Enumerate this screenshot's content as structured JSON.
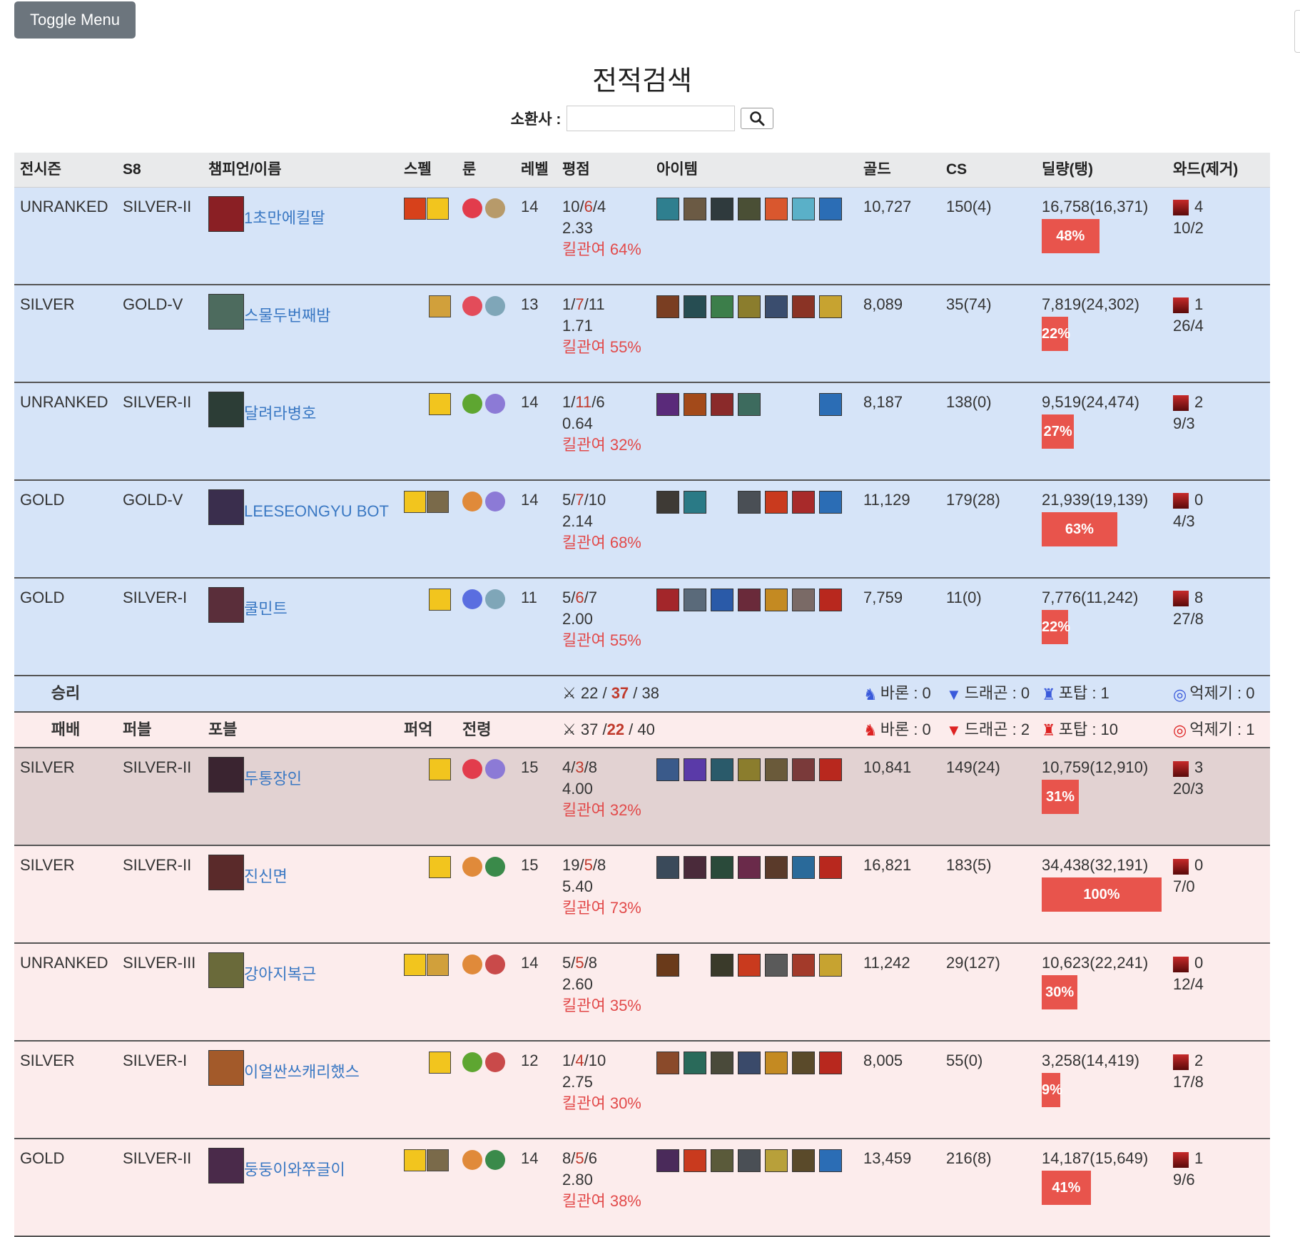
{
  "toggle_label": "Toggle Menu",
  "title": "전적검색",
  "search": {
    "label": "소환사 :",
    "value": "",
    "placeholder": ""
  },
  "columns": [
    "전시즌",
    "S8",
    "챔피언/이름",
    "스펠",
    "룬",
    "레벨",
    "평점",
    "아이템",
    "골드",
    "CS",
    "딜량(탱)",
    "와드(제거)"
  ],
  "win_team": [
    {
      "prev": "UNRANKED",
      "s8": "SILVER-II",
      "name": "1초만에킬딸",
      "portrait": "#8a1f24",
      "spells": [
        "#d7411b",
        "#f2c51e"
      ],
      "runes": [
        "#e23c4c",
        "#b79a6a"
      ],
      "level": "14",
      "kills": "10",
      "deaths": "6",
      "assists": "4",
      "kda": "2.33",
      "kp": "킬관여 64%",
      "items": [
        "#2f7f8f",
        "#6b5a44",
        "#2f3a3d",
        "#4a4f35",
        "#d9572e",
        "#5ab0c8",
        "#2b6db5"
      ],
      "gold": "10,727",
      "cs": "150(4)",
      "damage": "16,758(16,371)",
      "dmg_pct": 0.48,
      "dmg_label": "48%",
      "wards": "4",
      "ward_kd": "10/2"
    },
    {
      "prev": "SILVER",
      "s8": "GOLD-V",
      "name": "스물두번째밤",
      "portrait": "#4d6b5e",
      "spells": [
        "#d1a03b"
      ],
      "runes": [
        "#e34c5a",
        "#7fa6b8"
      ],
      "level": "13",
      "kills": "1",
      "deaths": "7",
      "assists": "11",
      "kda": "1.71",
      "kp": "킬관여 55%",
      "items": [
        "#7a3e22",
        "#264d52",
        "#3c7e4a",
        "#8b7d2d",
        "#3a4d6e",
        "#8a3325",
        "#c7a330"
      ],
      "gold": "8,089",
      "cs": "35(74)",
      "damage": "7,819(24,302)",
      "dmg_pct": 0.22,
      "dmg_label": "22%",
      "wards": "1",
      "ward_kd": "26/4"
    },
    {
      "prev": "UNRANKED",
      "s8": "SILVER-II",
      "name": "달려라병호",
      "portrait": "#2c3d36",
      "spells": [
        "#f2c51e"
      ],
      "runes": [
        "#5ea631",
        "#8c7ad6"
      ],
      "level": "14",
      "kills": "1",
      "deaths": "11",
      "assists": "6",
      "kda": "0.64",
      "kp": "킬관여 32%",
      "items": [
        "#5a2a7a",
        "#a34a1a",
        "#8a2a2a",
        "#3d6b5e",
        "",
        "",
        "#2b6db5"
      ],
      "gold": "8,187",
      "cs": "138(0)",
      "damage": "9,519(24,474)",
      "dmg_pct": 0.27,
      "dmg_label": "27%",
      "wards": "2",
      "ward_kd": "9/3"
    },
    {
      "prev": "GOLD",
      "s8": "GOLD-V",
      "name": "LEESEONGYU BOT",
      "portrait": "#3a2e4d",
      "spells": [
        "#f2c51e",
        "#7a6a4a"
      ],
      "runes": [
        "#e08a3a",
        "#8c7ad6"
      ],
      "level": "14",
      "kills": "5",
      "deaths": "7",
      "assists": "10",
      "kda": "2.14",
      "kp": "킬관여 68%",
      "items": [
        "#3e3a35",
        "#2a7a86",
        "",
        "#4a4f55",
        "#c93a1e",
        "#a82a2a",
        "#2b6db5"
      ],
      "gold": "11,129",
      "cs": "179(28)",
      "damage": "21,939(19,139)",
      "dmg_pct": 0.63,
      "dmg_label": "63%",
      "wards": "0",
      "ward_kd": "4/3"
    },
    {
      "prev": "GOLD",
      "s8": "SILVER-I",
      "name": "쿨민트",
      "portrait": "#5a2e3a",
      "spells": [
        "#f2c51e"
      ],
      "runes": [
        "#5a6ee0",
        "#7fa6b8"
      ],
      "level": "11",
      "kills": "5",
      "deaths": "6",
      "assists": "7",
      "kda": "2.00",
      "kp": "킬관여 55%",
      "items": [
        "#a3262a",
        "#5a6a7a",
        "#2a5aa8",
        "#6a2a3a",
        "#c48a22",
        "#7a6a66",
        "#b8281e"
      ],
      "gold": "7,759",
      "cs": "11(0)",
      "damage": "7,776(11,242)",
      "dmg_pct": 0.22,
      "dmg_label": "22%",
      "wards": "8",
      "ward_kd": "27/8"
    }
  ],
  "win_summary": {
    "label": "승리",
    "kills": "22",
    "deaths": "37",
    "assists": "38",
    "baron": "바론 : 0",
    "dragon": "드래곤 : 0",
    "tower": "포탑 : 1",
    "inhib": "억제기 : 0"
  },
  "lose_summary": {
    "label": "패배",
    "col2": "퍼블",
    "col3": "포블",
    "col4": "퍼억",
    "col5": "전령",
    "kills": "37",
    "deaths": "22",
    "assists": "40",
    "baron": "바론 : 0",
    "dragon": "드래곤 : 2",
    "tower": "포탑 : 10",
    "inhib": "억제기 : 1"
  },
  "lose_team": [
    {
      "prev": "SILVER",
      "s8": "SILVER-II",
      "name": "두통장인",
      "portrait": "#3a2430",
      "spells": [
        "#f2c51e"
      ],
      "runes": [
        "#e23c4c",
        "#8c7ad6"
      ],
      "level": "15",
      "kills": "4",
      "deaths": "3",
      "assists": "8",
      "kda": "4.00",
      "kp": "킬관여 32%",
      "items": [
        "#3a5a8a",
        "#5a3aa8",
        "#2a5a6a",
        "#8b7d2d",
        "#6a5a3a",
        "#7a3a3a",
        "#b8281e"
      ],
      "gold": "10,841",
      "cs": "149(24)",
      "damage": "10,759(12,910)",
      "dmg_pct": 0.31,
      "dmg_label": "31%",
      "wards": "3",
      "ward_kd": "20/3"
    },
    {
      "prev": "SILVER",
      "s8": "SILVER-II",
      "name": "진신면",
      "portrait": "#5a2a2a",
      "spells": [
        "#f2c51e"
      ],
      "runes": [
        "#e08a3a",
        "#3a8a4a"
      ],
      "level": "15",
      "kills": "19",
      "deaths": "5",
      "assists": "8",
      "kda": "5.40",
      "kp": "킬관여 73%",
      "items": [
        "#3a4a5a",
        "#4a2a3a",
        "#2a4a3a",
        "#6a2a4a",
        "#5a3a2a",
        "#2a6a9a",
        "#b8281e"
      ],
      "gold": "16,821",
      "cs": "183(5)",
      "damage": "34,438(32,191)",
      "dmg_pct": 1.0,
      "dmg_label": "100%",
      "wards": "0",
      "ward_kd": "7/0"
    },
    {
      "prev": "UNRANKED",
      "s8": "SILVER-III",
      "name": "강아지복근",
      "portrait": "#6a6a3a",
      "spells": [
        "#f2c51e",
        "#d1a03b"
      ],
      "runes": [
        "#e08a3a",
        "#c94a4a"
      ],
      "level": "14",
      "kills": "5",
      "deaths": "5",
      "assists": "8",
      "kda": "2.60",
      "kp": "킬관여 35%",
      "items": [
        "#6a3a1a",
        "",
        "#3a3a2a",
        "#c93a1e",
        "#5a5a5a",
        "#a33a2a",
        "#c7a330"
      ],
      "gold": "11,242",
      "cs": "29(127)",
      "damage": "10,623(22,241)",
      "dmg_pct": 0.3,
      "dmg_label": "30%",
      "wards": "0",
      "ward_kd": "12/4"
    },
    {
      "prev": "SILVER",
      "s8": "SILVER-I",
      "name": "이얼싼쓰캐리했스",
      "portrait": "#a35a2a",
      "spells": [
        "#f2c51e"
      ],
      "runes": [
        "#5ea631",
        "#c94a4a"
      ],
      "level": "12",
      "kills": "1",
      "deaths": "4",
      "assists": "10",
      "kda": "2.75",
      "kp": "킬관여 30%",
      "items": [
        "#8a4a2a",
        "#2a6a5a",
        "#4a4a3a",
        "#3a4a6a",
        "#c48a22",
        "#5a4a2a",
        "#b8281e"
      ],
      "gold": "8,005",
      "cs": "55(0)",
      "damage": "3,258(14,419)",
      "dmg_pct": 0.09,
      "dmg_label": "9%",
      "wards": "2",
      "ward_kd": "17/8"
    },
    {
      "prev": "GOLD",
      "s8": "SILVER-II",
      "name": "둥둥이와쭈글이",
      "portrait": "#4a2a4a",
      "spells": [
        "#f2c51e",
        "#7a6a4a"
      ],
      "runes": [
        "#e08a3a",
        "#3a8a4a"
      ],
      "level": "14",
      "kills": "8",
      "deaths": "5",
      "assists": "6",
      "kda": "2.80",
      "kp": "킬관여 38%",
      "items": [
        "#4a2a5a",
        "#c93a1e",
        "#5a5a3a",
        "#4a4f55",
        "#b8a03a",
        "#5a4a2a",
        "#2b6db5"
      ],
      "gold": "13,459",
      "cs": "216(8)",
      "damage": "14,187(15,649)",
      "dmg_pct": 0.41,
      "dmg_label": "41%",
      "wards": "1",
      "ward_kd": "9/6"
    }
  ]
}
